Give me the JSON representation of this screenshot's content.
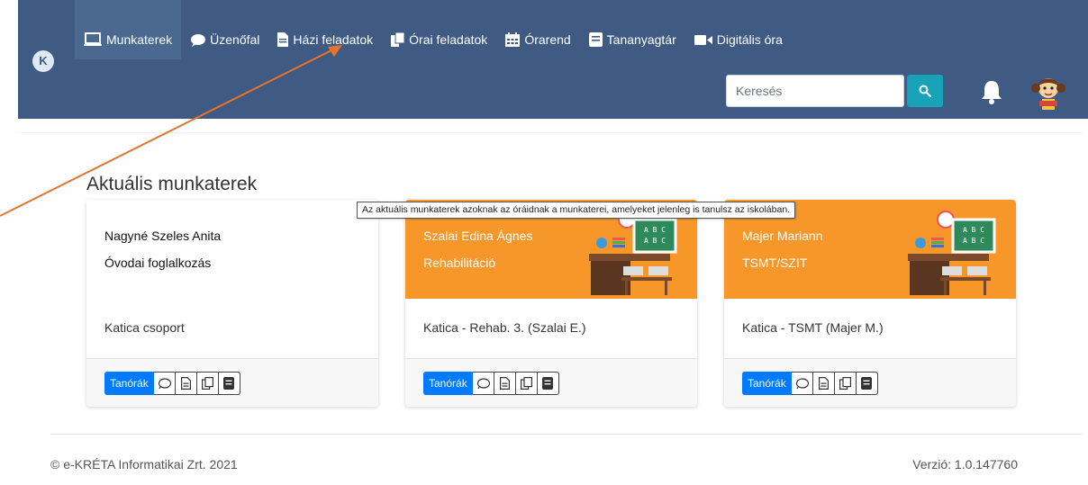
{
  "nav": {
    "items": [
      {
        "label": "Munkaterek",
        "icon": "laptop-icon",
        "active": true
      },
      {
        "label": "Üzenőfal",
        "icon": "speech-bubble-icon"
      },
      {
        "label": "Házi feladatok",
        "icon": "document-icon"
      },
      {
        "label": "Órai feladatok",
        "icon": "copy-icon"
      },
      {
        "label": "Órarend",
        "icon": "calendar-icon"
      },
      {
        "label": "Tananyagtár",
        "icon": "book-icon"
      },
      {
        "label": "Digitális óra",
        "icon": "video-camera-icon"
      }
    ]
  },
  "header": {
    "logo_letter": "K",
    "search_placeholder": "Keresés"
  },
  "section": {
    "title": "Aktuális munkaterek",
    "tooltip": "Az aktuális munkaterek azoknak az óráidnak a munkaterei, amelyeket jelenleg is tanulsz az iskolában."
  },
  "cards": [
    {
      "teacher": "Nagyné Szeles Anita",
      "subject": "Óvodai foglalkozás",
      "group": "Katica csoport",
      "theme": "white"
    },
    {
      "teacher": "Szalai Edina Ágnes",
      "subject": "Rehabilitáció",
      "group": "Katica - Rehab. 3. (Szalai E.)",
      "theme": "orange"
    },
    {
      "teacher": "Majer Mariann",
      "subject": "TSMT/SZIT",
      "group": "Katica - TSMT (Majer M.)",
      "theme": "orange"
    }
  ],
  "card_actions": {
    "primary_label": "Tanórák",
    "icons": [
      "speech-bubble-icon",
      "document-icon",
      "copy-icon",
      "book-icon"
    ]
  },
  "footer": {
    "copyright": "© e-KRÉTA Informatikai Zrt. 2021",
    "version": "Verzió: 1.0.147760"
  },
  "colors": {
    "header": "#3f5a83",
    "accent_orange": "#f7972a",
    "primary": "#007bff",
    "search_button": "#17a2b8",
    "annotation_arrow": "#e8742a"
  }
}
